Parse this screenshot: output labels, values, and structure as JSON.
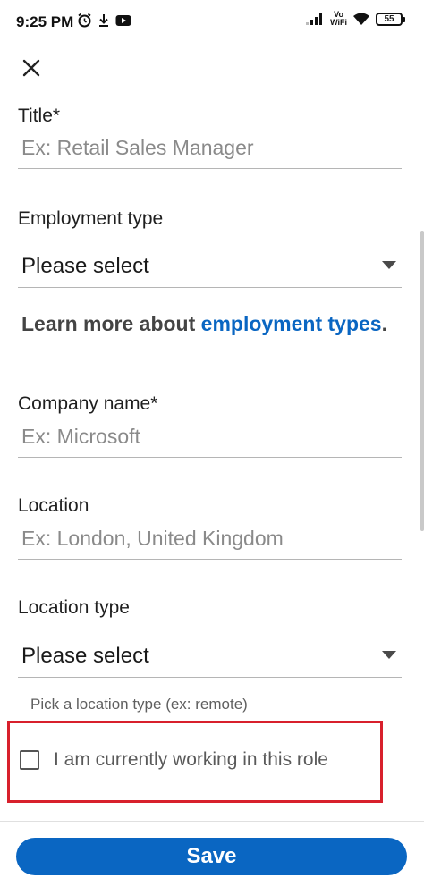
{
  "status_bar": {
    "time": "9:25 PM",
    "icons": [
      "alarm-icon",
      "download-icon",
      "youtube-icon",
      "signal-icon",
      "vowifi-icon",
      "wifi-icon",
      "battery-icon"
    ],
    "vowifi_top": "Vo",
    "vowifi_bottom": "WiFi",
    "battery_level": "55"
  },
  "header": {
    "close_icon": "close-icon"
  },
  "form": {
    "title_label": "Title*",
    "title_placeholder": "Ex: Retail Sales Manager",
    "employment_type_label": "Employment type",
    "employment_type_value": "Please select",
    "learn_more_prefix": "Learn more about ",
    "learn_more_link": "employment types",
    "learn_more_suffix": ".",
    "company_label": "Company name*",
    "company_placeholder": "Ex: Microsoft",
    "location_label": "Location",
    "location_placeholder": "Ex: London, United Kingdom",
    "location_type_label": "Location type",
    "location_type_value": "Please select",
    "location_type_helper": "Pick a location type (ex: remote)",
    "current_role_label": "I am currently working in this role",
    "current_role_checked": false
  },
  "footer": {
    "save_label": "Save"
  },
  "colors": {
    "accent": "#0a66c2",
    "highlight": "#d8202c"
  }
}
